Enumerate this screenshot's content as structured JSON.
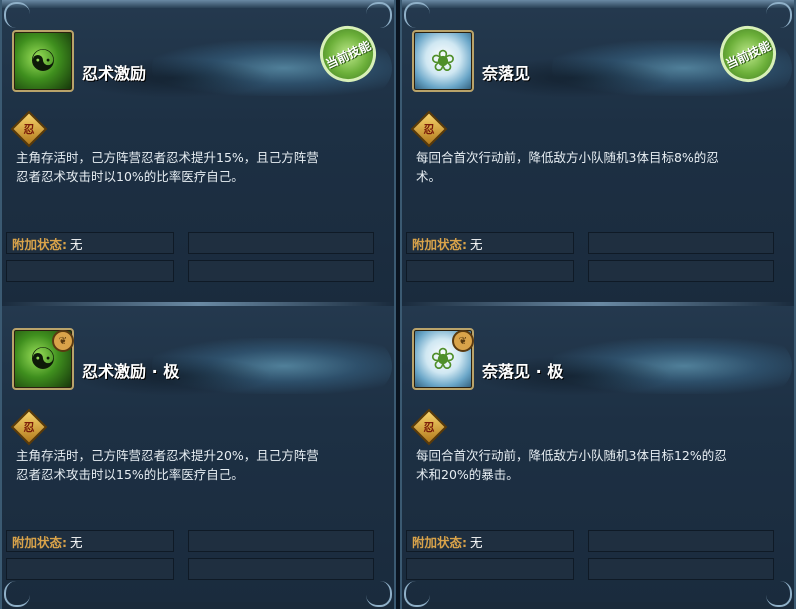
{
  "current_skill_stamp": "当前技能",
  "status_label": "附加状态:",
  "colors": {
    "frame": "#3b5a72",
    "panel": "#1a2b3d",
    "stamp": "#6cb03a",
    "status_label": "#d9a34a"
  },
  "left": {
    "top": {
      "icon": "ninja-figure-icon",
      "name": "忍术激励",
      "badge": "忍",
      "desc_line1": "主角存活时，己方阵营忍者忍术提升15%，且己方阵营",
      "desc_line2": "忍者忍术攻击时以10%的比率医疗自己。",
      "status_value": "无"
    },
    "bottom": {
      "icon": "ninja-figure-icon",
      "name": "忍术激励 · 极",
      "badge": "忍",
      "desc_line1": "主角存活时，己方阵营忍者忍术提升20%，且己方阵营",
      "desc_line2": "忍者忍术攻击时以15%的比率医疗自己。",
      "status_value": "无"
    }
  },
  "right": {
    "top": {
      "icon": "tornado-leaf-icon",
      "name": "奈落见",
      "badge": "忍",
      "desc_line1": "每回合首次行动前，降低敌方小队随机3体目标8%的忍",
      "desc_line2": "术。",
      "status_value": "无"
    },
    "bottom": {
      "icon": "tornado-leaf-icon",
      "name": "奈落见 · 极",
      "badge": "忍",
      "desc_line1": "每回合首次行动前，降低敌方小队随机3体目标12%的忍",
      "desc_line2": "术和20%的暴击。",
      "status_value": "无"
    }
  }
}
